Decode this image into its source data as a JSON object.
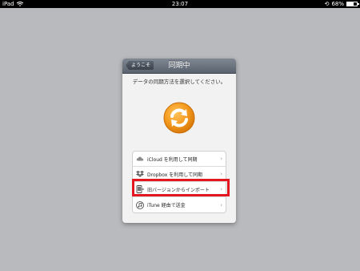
{
  "status_bar": {
    "device": "iPad",
    "time": "23:07",
    "battery": "68%"
  },
  "nav": {
    "back_label": "ようこそ",
    "title": "同期中"
  },
  "subtitle": "データの同期方法を選択してください。",
  "options": [
    {
      "label": "iCloud を利用して同期",
      "icon": "cloud-icon"
    },
    {
      "label": "Dropbox を利用して同期",
      "icon": "dropbox-icon"
    },
    {
      "label": "旧バージョンからインポート",
      "icon": "phone-import-icon"
    },
    {
      "label": "iTune 経由で送金",
      "icon": "music-note-icon"
    }
  ],
  "colors": {
    "background": "#b9babd",
    "accent_orange": "#f39a1e",
    "highlight_red": "#e3171f"
  }
}
